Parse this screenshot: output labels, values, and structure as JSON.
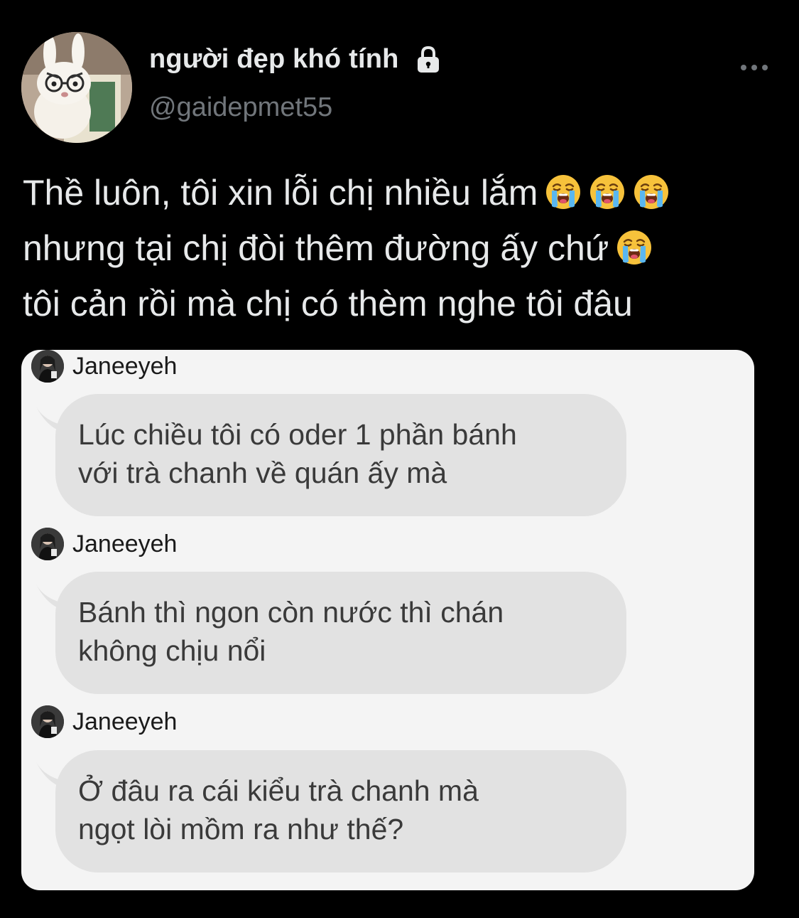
{
  "profile": {
    "display_name": "người đẹp khó tính",
    "handle": "@gaidepmet55",
    "protected_icon": "lock-icon",
    "menu_icon": "more-horizontal-icon"
  },
  "tweet": {
    "lines": [
      "Thề luôn, tôi xin lỗi chị nhiều lắm",
      "nhưng tại chị đòi thêm đường ấy chứ",
      "tôi cản rồi mà chị có thèm nghe tôi đâu"
    ],
    "emoji": "loudly-crying-face"
  },
  "chat": {
    "messages": [
      {
        "sender": "Janeeyeh",
        "lines": [
          "Lúc chiều tôi có oder 1 phần bánh",
          "với trà chanh về quán ấy mà"
        ]
      },
      {
        "sender": "Janeeyeh",
        "lines": [
          "Bánh thì ngon còn nước thì chán",
          "không chịu nổi"
        ]
      },
      {
        "sender": "Janeeyeh",
        "lines": [
          "Ở đâu ra cái kiểu trà chanh mà",
          "ngọt lòi mồm ra như thế?"
        ]
      }
    ]
  },
  "colors": {
    "background": "#000000",
    "text_primary": "#e7e9ea",
    "text_secondary": "#71767b",
    "card_background": "#f4f4f4",
    "bubble_background": "#e2e2e2"
  }
}
